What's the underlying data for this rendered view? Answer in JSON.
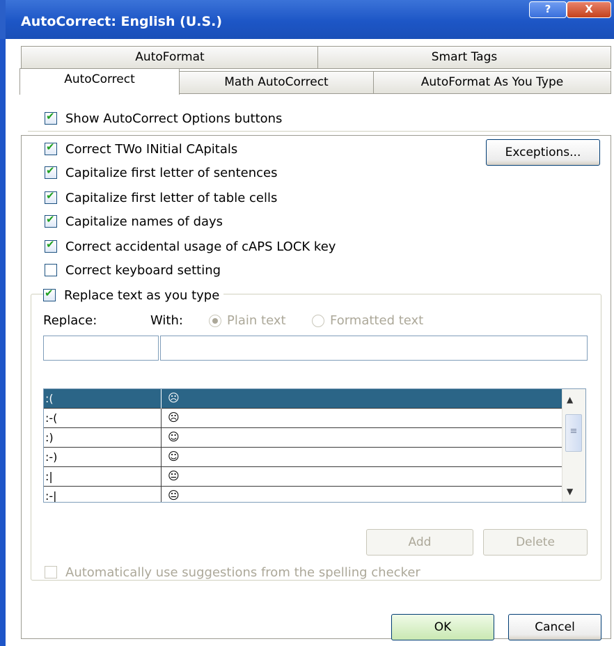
{
  "window": {
    "title": "AutoCorrect: English (U.S.)",
    "help_glyph": "?",
    "close_glyph": "X"
  },
  "tabs": {
    "row1": [
      "AutoFormat",
      "Smart Tags"
    ],
    "row2": [
      "AutoCorrect",
      "Math AutoCorrect",
      "AutoFormat As You Type"
    ]
  },
  "options": {
    "show_buttons": {
      "label": "Show AutoCorrect Options buttons",
      "checked": true
    },
    "two_initial_caps": {
      "label": "Correct TWo INitial CApitals",
      "checked": true
    },
    "first_letter_sentences": {
      "label": "Capitalize first letter of sentences",
      "checked": true
    },
    "first_letter_cells": {
      "label": "Capitalize first letter of table cells",
      "checked": true
    },
    "names_of_days": {
      "label": "Capitalize names of days",
      "checked": true
    },
    "caps_lock": {
      "label": "Correct accidental usage of cAPS LOCK key",
      "checked": true
    },
    "keyboard_setting": {
      "label": "Correct keyboard setting",
      "checked": false
    },
    "replace_text": {
      "label": "Replace text as you type",
      "checked": true
    }
  },
  "buttons": {
    "exceptions": "Exceptions...",
    "add": "Add",
    "delete": "Delete",
    "ok": "OK",
    "cancel": "Cancel"
  },
  "replace": {
    "replace_label": "Replace:",
    "with_label": "With:",
    "plain_text": "Plain text",
    "formatted_text": "Formatted text",
    "replace_value": "",
    "with_value": ""
  },
  "entries": [
    {
      "from": ":(",
      "to": "☹",
      "selected": true
    },
    {
      "from": ":-(",
      "to": "☹",
      "selected": false
    },
    {
      "from": ":)",
      "to": "☺",
      "selected": false
    },
    {
      "from": ":-)",
      "to": "☺",
      "selected": false
    },
    {
      "from": ":|",
      "to": "😐",
      "selected": false
    },
    {
      "from": ":-|",
      "to": "😐",
      "selected": false
    }
  ],
  "spelling_suggestions": {
    "label": "Automatically use suggestions from the spelling checker",
    "checked": false,
    "enabled": false
  },
  "icons": {
    "checkmark": "checkmark-icon",
    "scroll_up": "scroll-up-arrow-icon",
    "scroll_down": "scroll-down-arrow-icon",
    "grip": "scroll-grip-icon"
  },
  "colors": {
    "titlebar": "#1d56c6",
    "selection": "#2b6587",
    "check": "#21a121"
  }
}
